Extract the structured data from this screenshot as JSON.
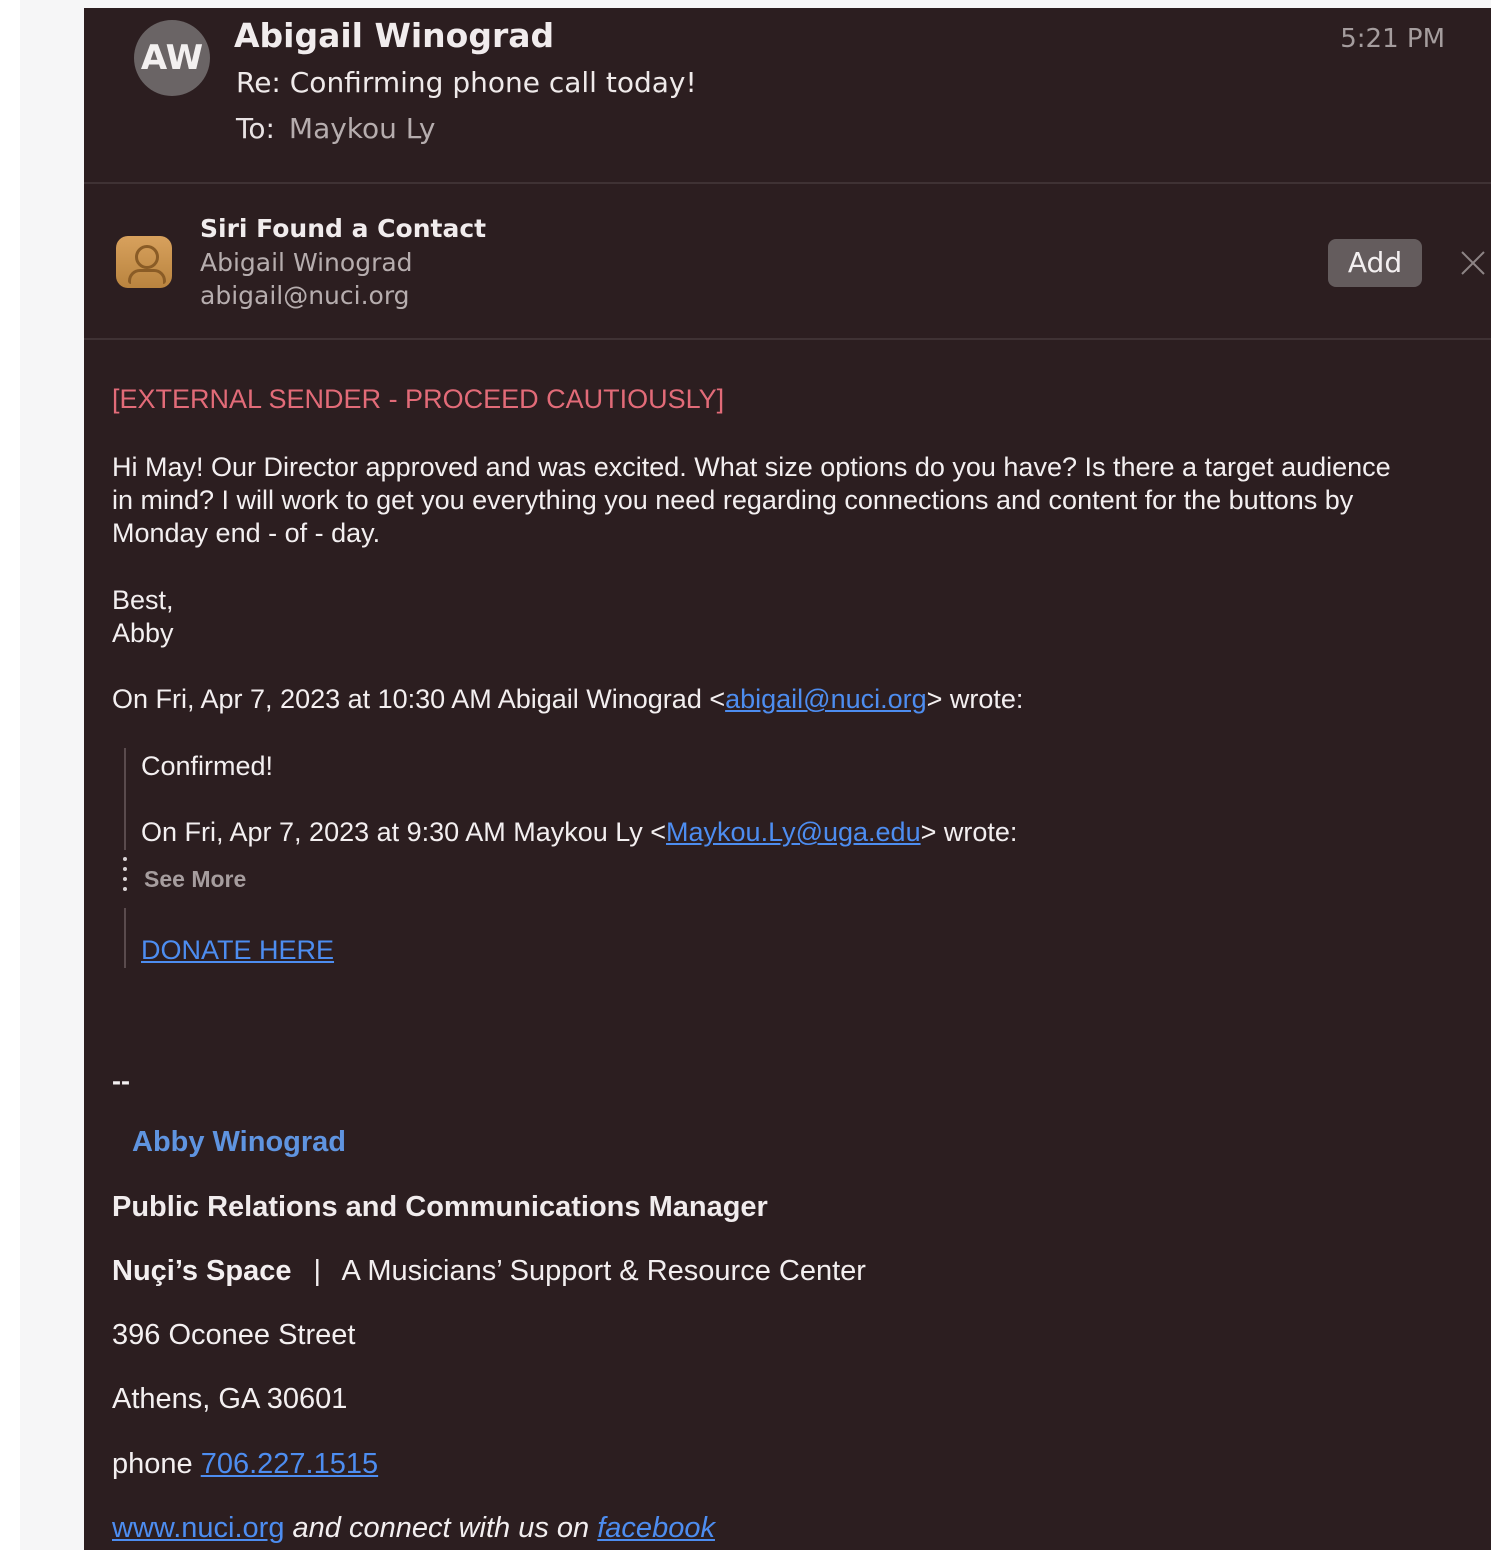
{
  "header": {
    "avatar_initials": "AW",
    "sender": "Abigail Winograd",
    "subject": "Re: Confirming phone call today!",
    "to_label": "To:",
    "to_value": "Maykou Ly",
    "time": "5:21 PM"
  },
  "siri": {
    "title": "Siri Found a Contact",
    "name": "Abigail Winograd",
    "email": "abigail@nuci.org",
    "add_label": "Add"
  },
  "body": {
    "warning": "[EXTERNAL SENDER - PROCEED CAUTIOUSLY]",
    "paragraph_lines": [
      "Hi May! Our Director approved and was excited. What size options do you have? Is there a target audience",
      "in mind? I will work to get you everything you need regarding connections and content for the buttons by",
      "Monday end - of - day."
    ],
    "closing": "Best,",
    "signoff": "Abby",
    "reply_intro_prefix": "On Fri, Apr 7, 2023 at 10:30 AM Abigail Winograd <",
    "reply_intro_email": "abigail@nuci.org",
    "reply_intro_suffix": "> wrote:",
    "quoted_confirmed": "Confirmed!",
    "quoted_intro_prefix": "On Fri, Apr 7, 2023 at 9:30 AM Maykou Ly <",
    "quoted_intro_email": "Maykou.Ly@uga.edu",
    "quoted_intro_suffix": "> wrote:",
    "see_more": "See More",
    "donate_link": "DONATE HERE"
  },
  "signature": {
    "dashes": "--",
    "name": "Abby Winograd",
    "title": "Public Relations and Communications Manager",
    "org": "Nuçi’s Space",
    "separator": "|",
    "org_tagline": "A Musicians’ Support & Resource Center",
    "street": "396 Oconee Street",
    "city": "Athens, GA 30601",
    "phone_label": "phone",
    "phone": "706.227.1515",
    "website": "www.nuci.org",
    "connect_text": "and connect with us on",
    "facebook": "facebook"
  },
  "colors": {
    "background": "#2c1e20",
    "warning": "#e26b78",
    "link": "#4d8df0",
    "signature_name": "#5f94e0"
  }
}
